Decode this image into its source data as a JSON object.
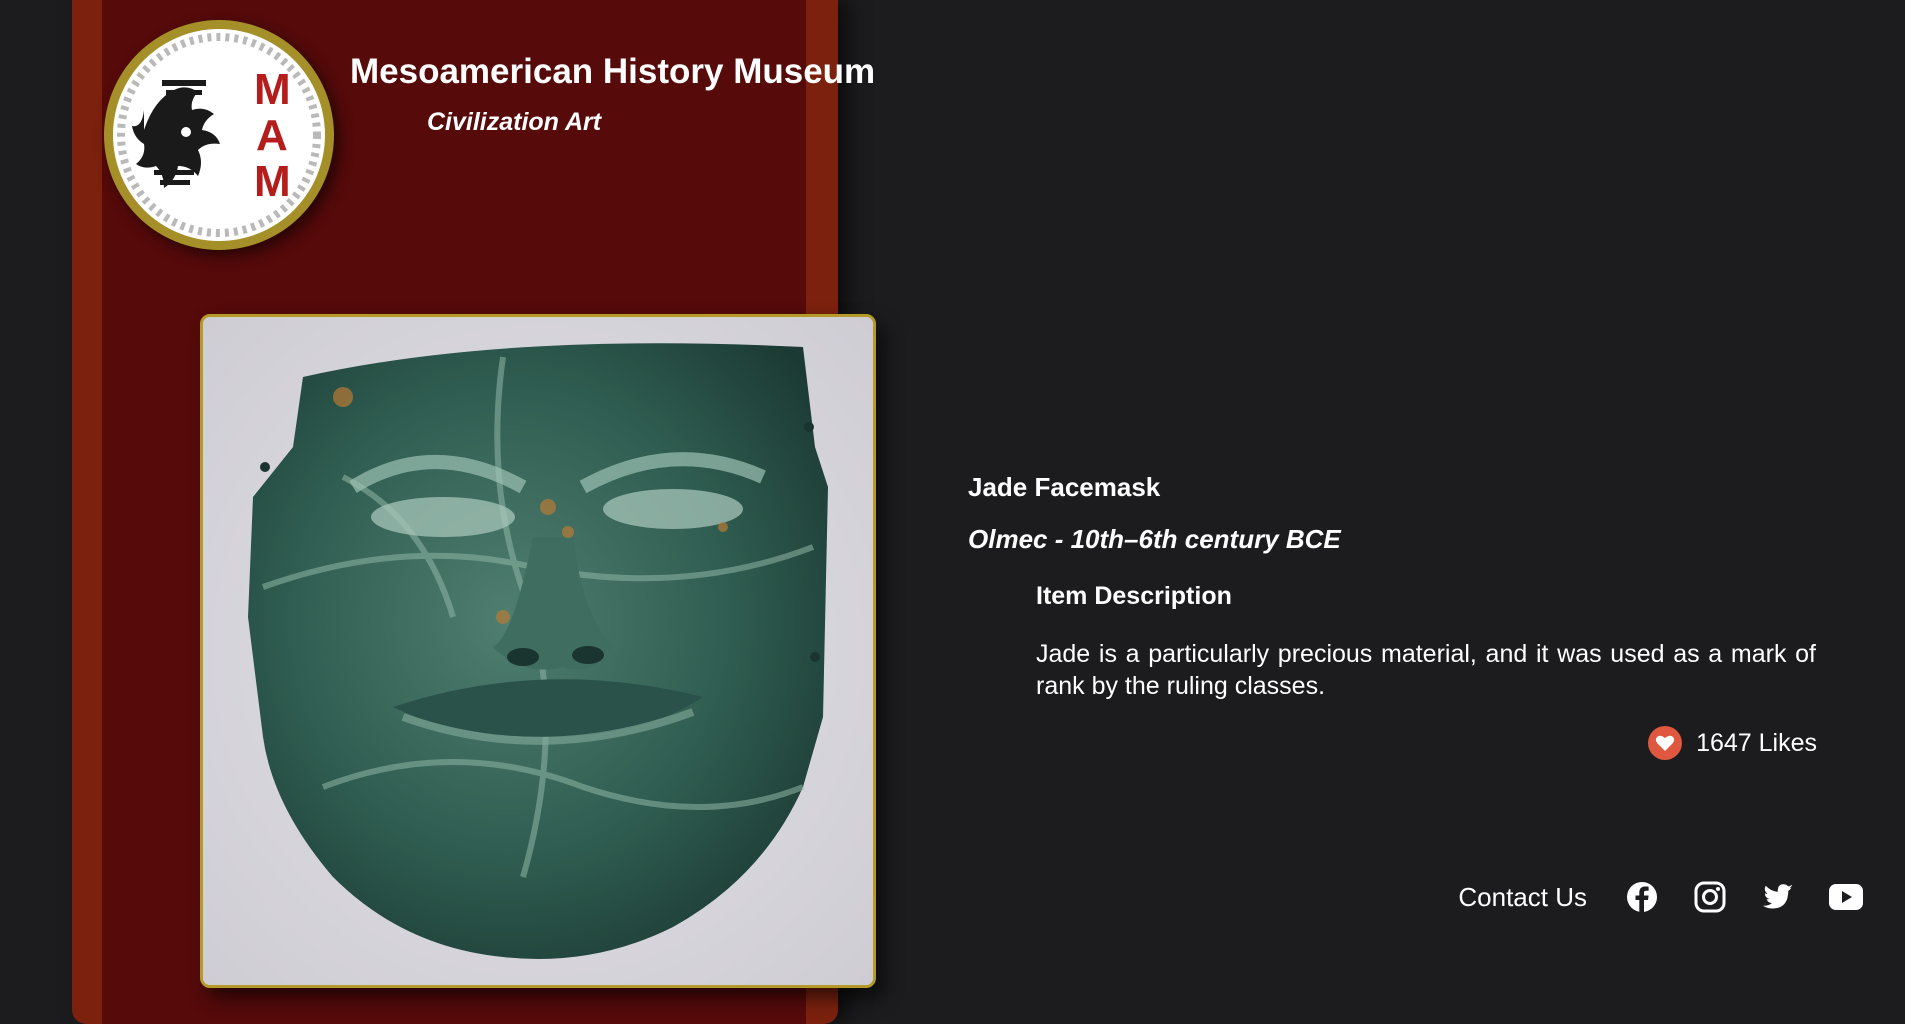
{
  "header": {
    "museum_name": "Mesoamerican History Museum",
    "subtitle": "Civilization Art",
    "logo_text": "MAM",
    "logo_letters": [
      "M",
      "A",
      "M"
    ]
  },
  "artifact": {
    "title": "Jade Facemask",
    "culture": "Olmec - 10th–6th century BCE",
    "description_heading": "Item Description",
    "description": "Jade is a particularly precious material, and it was used as a mark of rank by the ruling classes.",
    "likes_count": "1647",
    "likes_label": "Likes",
    "likes_text": "1647 Likes",
    "image_alt": "jade-olmec-facemask"
  },
  "footer": {
    "contact_label": "Contact Us",
    "social": [
      "facebook-icon",
      "instagram-icon",
      "twitter-icon",
      "youtube-icon"
    ]
  },
  "colors": {
    "page_bg": "#1c1c1e",
    "card_border": "#7b210e",
    "card_bg": "#560a0a",
    "gold": "#b59a2a",
    "like_red": "#e0573f",
    "logo_red": "#b51c1c"
  }
}
